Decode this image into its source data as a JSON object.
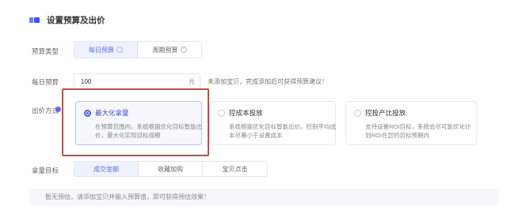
{
  "section": {
    "title": "设置预算及出价",
    "icon": "section-flag-icon",
    "accent": "#3b55ff"
  },
  "labels": {
    "budget_type": "预算类型",
    "daily_budget": "每日预算",
    "bid_method": "出价方式",
    "target": "拿量目标"
  },
  "budget_type": {
    "options": [
      {
        "label": "每日预算",
        "active": true
      },
      {
        "label": "周期预算",
        "active": false
      }
    ]
  },
  "daily_budget": {
    "value": "100",
    "unit": "元",
    "hint": "未添加宝贝，完成添加后可获得预算建议！"
  },
  "bid_methods": [
    {
      "title": "最大化拿量",
      "desc": "在预算范围内，系统根据优化目标智能出价，最大化实现目标规模",
      "selected": true
    },
    {
      "title": "控成本投放",
      "desc": "系统根据优化目标智能出价，控制平均成本尽量小于设置成本",
      "selected": false
    },
    {
      "title": "控投产比投放",
      "desc": "支持设置ROI目标，系统会尽可能优化计划ROI在您的目标预期内",
      "selected": false
    }
  ],
  "target": {
    "options": [
      {
        "label": "成交金额",
        "active": true
      },
      {
        "label": "收藏加购",
        "active": false
      },
      {
        "label": "宝贝点击",
        "active": false
      }
    ]
  },
  "notice": "暂无预估，请添加宝贝并输入预算值，即可获得预估效果！",
  "colors": {
    "highlight": "#c94a42",
    "primary": "#4a5cf0"
  }
}
